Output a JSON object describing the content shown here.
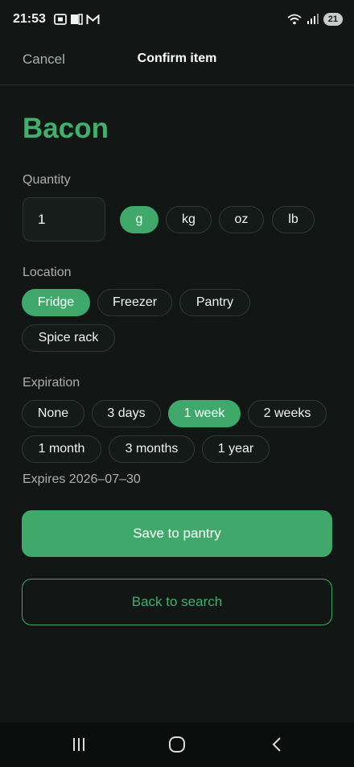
{
  "status_bar": {
    "time": "21:53",
    "battery": "21",
    "icons": [
      "screenshot-icon",
      "cast-icon",
      "gmail-icon",
      "wifi-icon",
      "signal-icon"
    ]
  },
  "header": {
    "cancel_label": "Cancel",
    "title": "Confirm item"
  },
  "item": {
    "name": "Bacon"
  },
  "quantity": {
    "label": "Quantity",
    "value": "1",
    "units": [
      {
        "label": "g",
        "selected": true
      },
      {
        "label": "kg",
        "selected": false
      },
      {
        "label": "oz",
        "selected": false
      },
      {
        "label": "lb",
        "selected": false
      }
    ]
  },
  "location": {
    "label": "Location",
    "options": [
      {
        "label": "Fridge",
        "selected": true
      },
      {
        "label": "Freezer",
        "selected": false
      },
      {
        "label": "Pantry",
        "selected": false
      },
      {
        "label": "Spice rack",
        "selected": false
      }
    ]
  },
  "expiration": {
    "label": "Expiration",
    "options": [
      {
        "label": "None",
        "selected": false
      },
      {
        "label": "3 days",
        "selected": false
      },
      {
        "label": "1 week",
        "selected": true
      },
      {
        "label": "2 weeks",
        "selected": false
      },
      {
        "label": "1 month",
        "selected": false
      },
      {
        "label": "3 months",
        "selected": false
      },
      {
        "label": "1 year",
        "selected": false
      }
    ],
    "expires_text": "Expires 2026–07–30"
  },
  "actions": {
    "save_label": "Save to pantry",
    "back_label": "Back to search"
  },
  "colors": {
    "accent": "#3fa86a",
    "background": "#121715"
  }
}
